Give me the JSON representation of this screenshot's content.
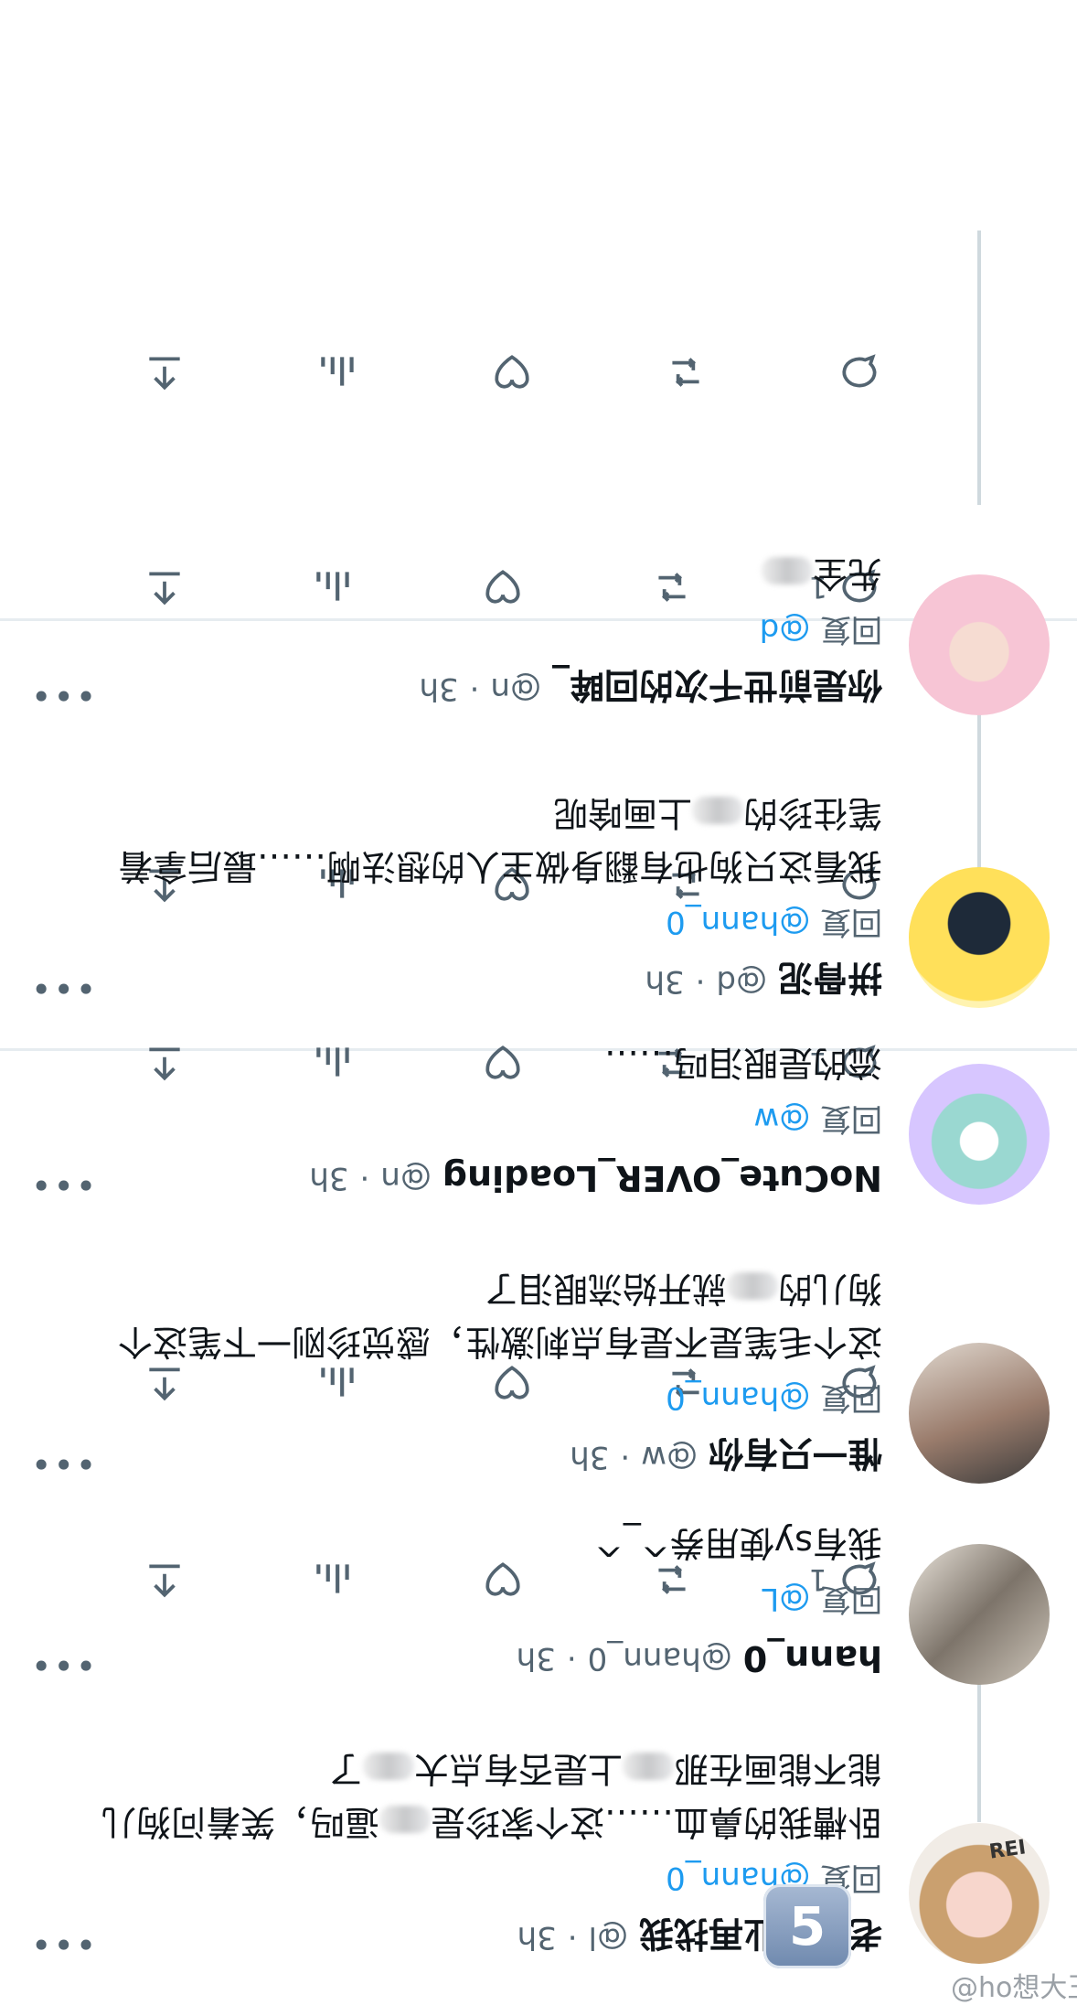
{
  "tweets": [
    {
      "name": "老公失业再找我",
      "handle": "@l",
      "time": "3h",
      "replying_label": "回复",
      "replying_to": "@hann_0",
      "text1": "卧槽我的鼻血……这个家珍是",
      "text1_tail": "逼吗，笑着问狗儿",
      "text2": "能不能画在那",
      "text2_tail": "上是否有点大",
      "text2_end": "了",
      "reply_count": "1"
    },
    {
      "name": "hann_0",
      "handle": "@hann_0",
      "time": "3h",
      "replying_label": "回复",
      "replying_to": "@L",
      "text1": "我有sy使用券^_^",
      "reply_count": ""
    },
    {
      "name": "惟一只有你",
      "handle": "@w",
      "time": "3h",
      "replying_label": "回复",
      "replying_to": "@hann_0",
      "text1": "这个毛笔是不是有点刺激性，感觉珍刚一下笔这个",
      "text2": "狗儿的",
      "text2_tail": "就开始流眼泪了",
      "reply_count": "1"
    },
    {
      "name": "NoCute_OVER_Loading",
      "handle": "@n",
      "time": "3h",
      "replying_label": "回复",
      "replying_to": "@w",
      "text1": "流的是眼泪吗……",
      "reply_count": ""
    },
    {
      "name": "拼骨泥",
      "handle": "@d",
      "time": "3h",
      "replying_label": "回复",
      "replying_to": "@hann_0",
      "text1": "我看这只狗也有翻身做主人的想法啊……最后拿着",
      "text2": "笔往珍的",
      "text2_tail": "上画啥呢",
      "reply_count": "1"
    },
    {
      "name": "你是前世千次的回眸_",
      "handle": "@n",
      "time": "3h",
      "replying_label": "回复",
      "replying_to": "@d",
      "text1": "先全",
      "text1_tail": "",
      "reply_count": ""
    }
  ],
  "overlay": {
    "badge": "5",
    "watermark": "@ho想大王",
    "avatar_tag": "REI"
  },
  "icons": [
    "reply-icon",
    "retweet-icon",
    "like-icon",
    "views-icon",
    "share-icon",
    "more-icon"
  ],
  "colors": {
    "accent": "#1d9bf0",
    "muted": "#536471",
    "divider": "#e6ecf0"
  }
}
